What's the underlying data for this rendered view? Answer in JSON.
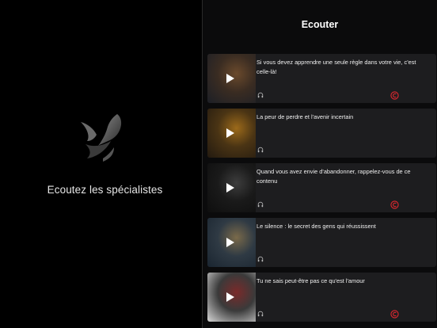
{
  "left": {
    "tagline": "Ecoutez les spécialistes"
  },
  "header": {
    "title": "Ecouter"
  },
  "colors": {
    "accent": "#e0282f",
    "card_bg": "#1d1d1f"
  },
  "items": [
    {
      "title": "Si vous devez apprendre une seule règle dans votre vie, c'est celle-là!",
      "badge": true,
      "icon": "headphones-icon",
      "thumb": [
        "#3a2c22",
        "#6b4a2c",
        "#1c1f26"
      ]
    },
    {
      "title": "La peur de perdre et l'avenir incertain",
      "badge": false,
      "icon": "headphones-icon",
      "thumb": [
        "#4a3414",
        "#9c6a1a",
        "#231a10"
      ]
    },
    {
      "title": "Quand vous avez envie d'abandonner, rappelez-vous de ce contenu",
      "badge": true,
      "icon": "headphones-icon",
      "thumb": [
        "#1a1a1a",
        "#3d3d3d",
        "#0e0e0e"
      ]
    },
    {
      "title": "Le silence : le secret des gens qui réussissent",
      "badge": false,
      "icon": "headphones-icon",
      "thumb": [
        "#2f3a44",
        "#7a6a4a",
        "#1a2530"
      ]
    },
    {
      "title": "Tu ne sais peut-être pas ce qu'est l'amour",
      "badge": true,
      "icon": "headphones-icon",
      "thumb": [
        "#3a3a3a",
        "#7a2a2a",
        "#d8d8d8"
      ]
    }
  ]
}
